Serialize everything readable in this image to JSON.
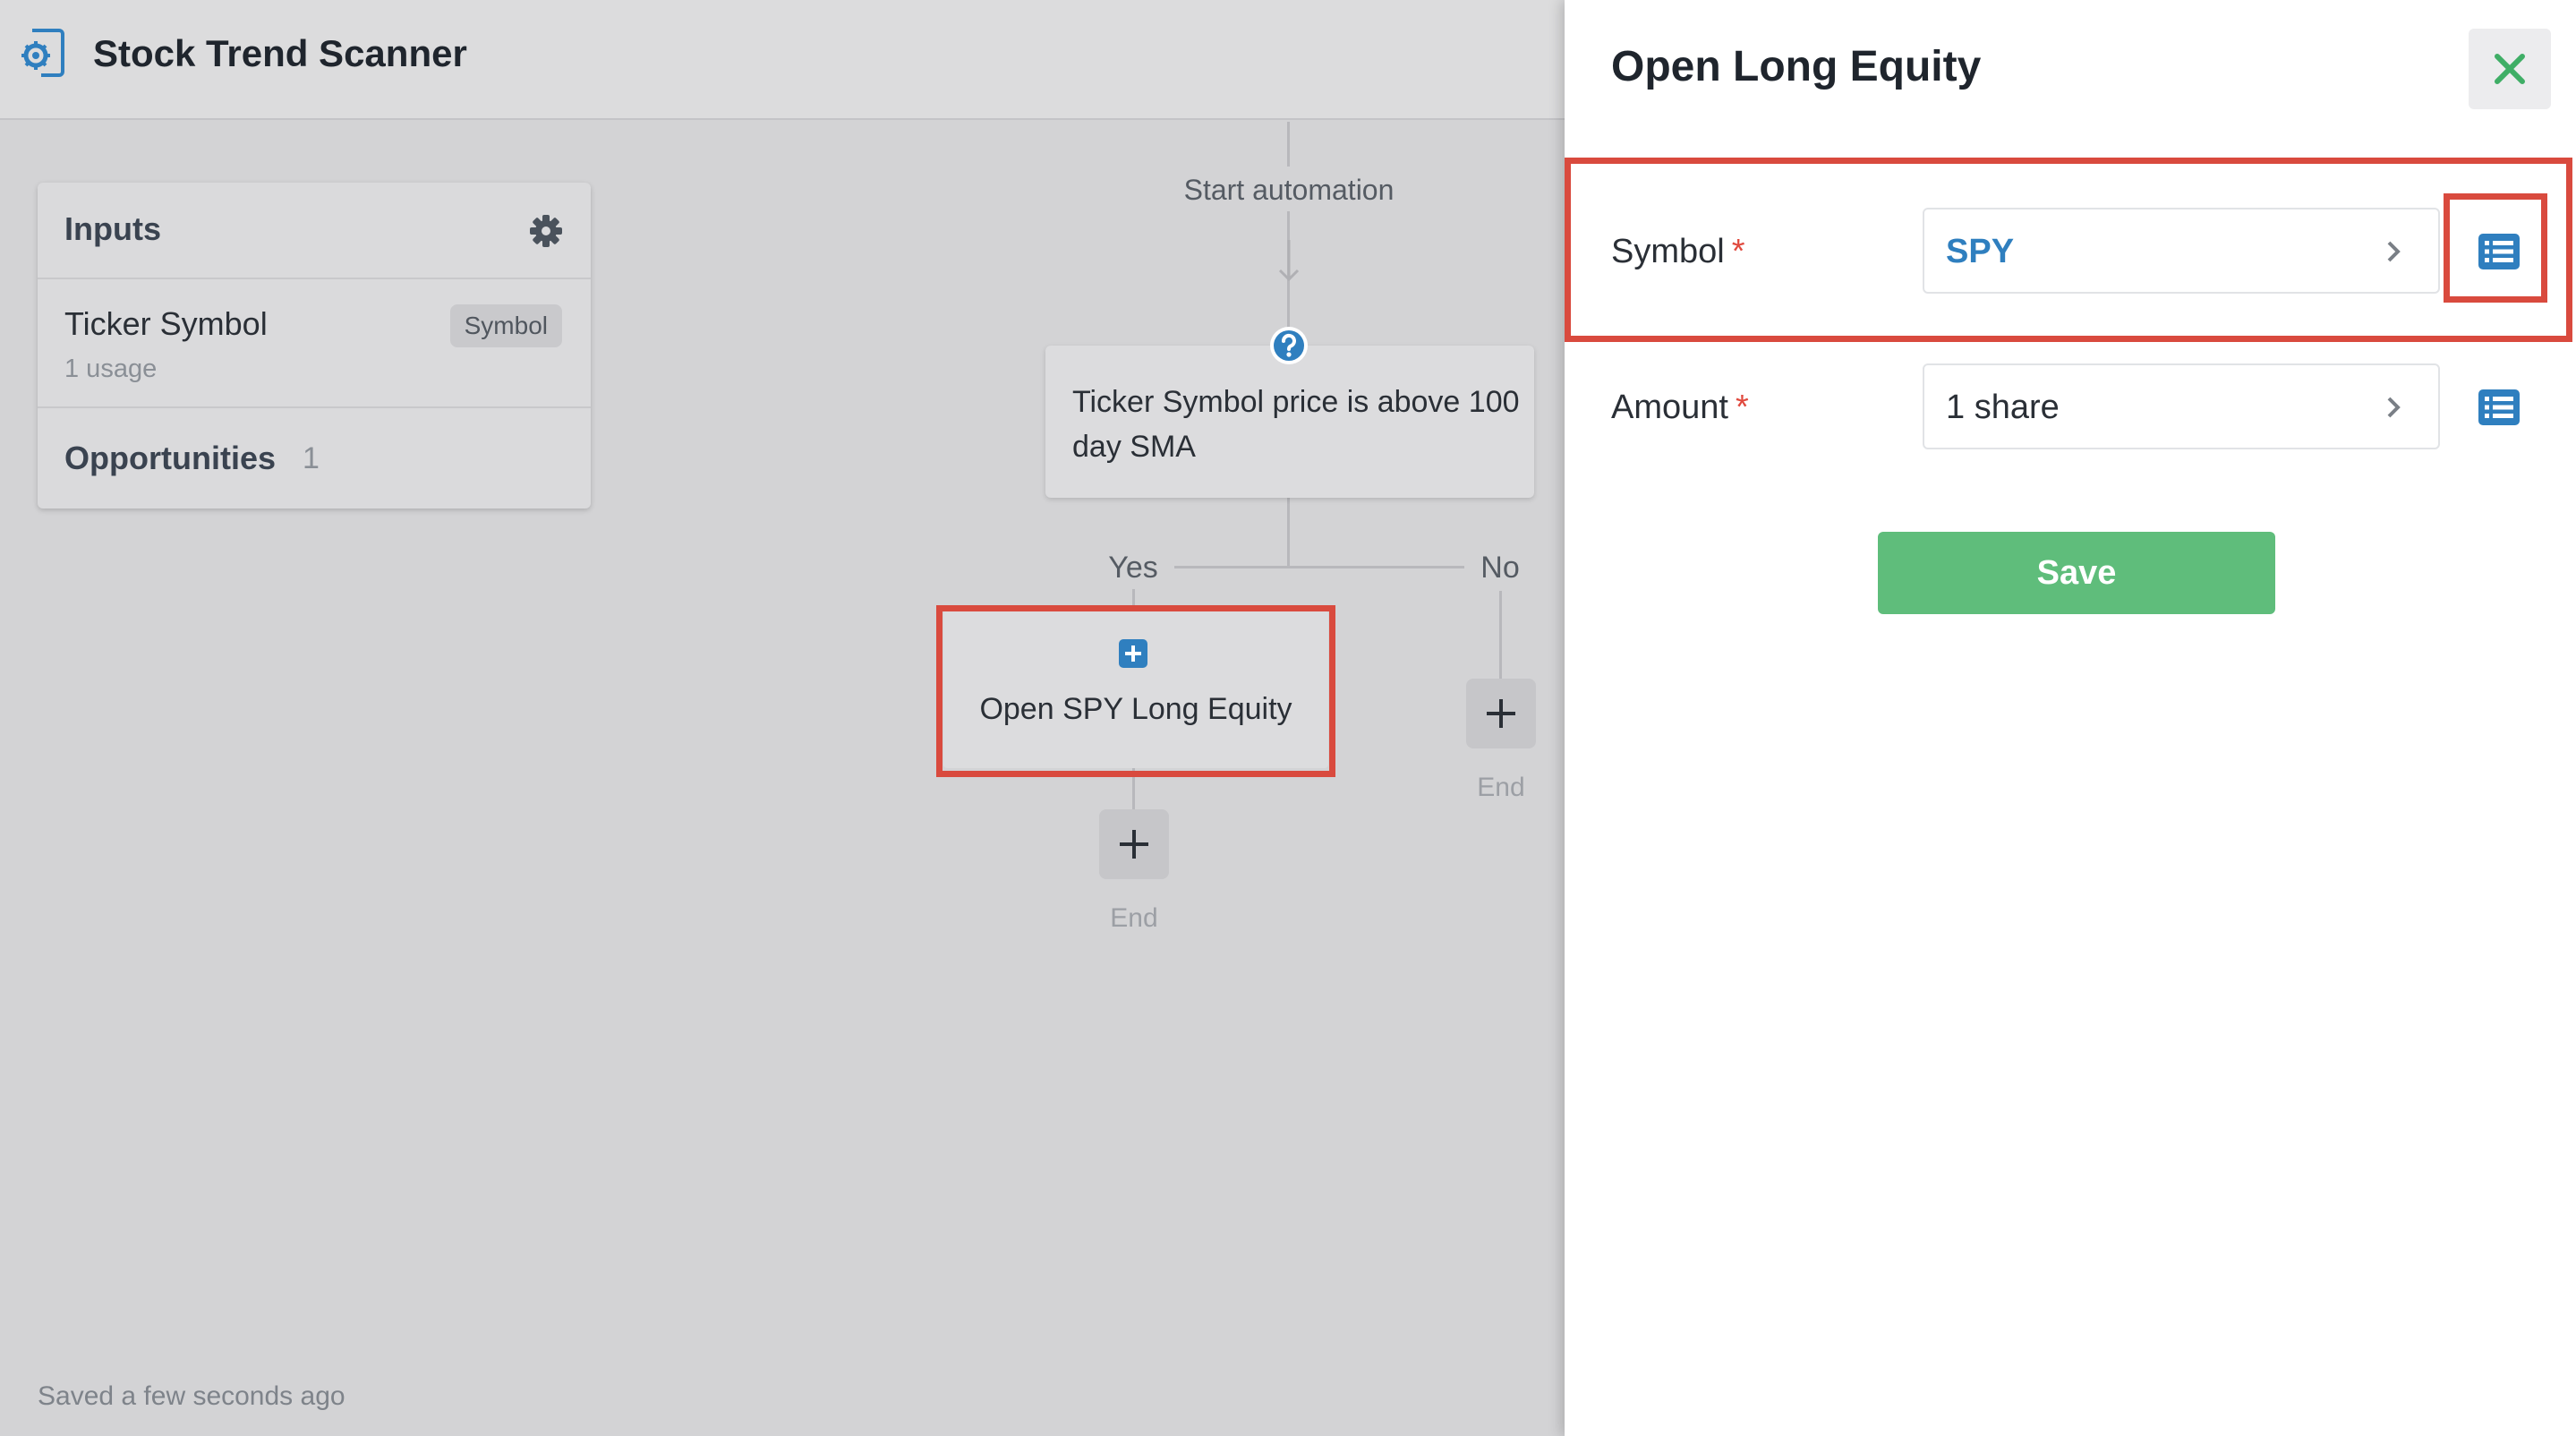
{
  "app": {
    "title": "Stock Trend Scanner",
    "icon": "gear-document-icon"
  },
  "inputs_panel": {
    "title": "Inputs",
    "settings_icon": "gear-icon",
    "items": [
      {
        "name": "Ticker Symbol",
        "usage": "1 usage",
        "badge": "Symbol"
      }
    ],
    "opportunities": {
      "label": "Opportunities",
      "count": "1"
    }
  },
  "flow": {
    "start_label": "Start automation",
    "condition": {
      "icon": "question-icon",
      "text": "Ticker Symbol price is above 100 day SMA"
    },
    "yes_label": "Yes",
    "no_label": "No",
    "action": {
      "icon": "plus-square-icon",
      "text": "Open SPY Long Equity"
    },
    "end_label": "End"
  },
  "status": {
    "saved": "Saved a few seconds ago"
  },
  "side_panel": {
    "title": "Open Long Equity",
    "close_icon": "close-icon",
    "fields": [
      {
        "label": "Symbol",
        "required_mark": "*",
        "value": "SPY"
      },
      {
        "label": "Amount",
        "required_mark": "*",
        "value": "1 share"
      }
    ],
    "save_label": "Save"
  },
  "colors": {
    "accent_blue": "#2f7fbf",
    "save_green": "#5fbd7b",
    "close_green": "#3fae66",
    "highlight_red": "#d94a3e",
    "required_red": "#e04a3f"
  }
}
